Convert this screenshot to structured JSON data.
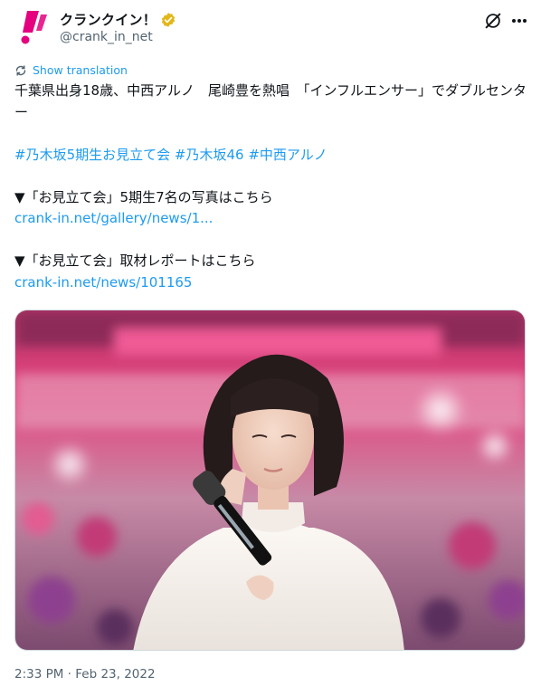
{
  "author": {
    "display_name": "クランクイン！",
    "handle": "@crank_in_net",
    "logo_glyph": "!"
  },
  "icons": {
    "verified": "verified-badge-icon",
    "grok": "grok-icon",
    "more": "more-icon",
    "translate": "translate-icon"
  },
  "colors": {
    "accent": "#1d9bf0",
    "brand_pink": "#e4007f",
    "verified_gold": "#e2b719"
  },
  "translate_label": "Show translation",
  "tweet": {
    "line1": "千葉県出身18歳、中西アルノ　尾崎豊を熱唱　「インフルエンサー」でダブルセンター",
    "hashtags": [
      "#乃木坂5期生お見立て会",
      "#乃木坂46",
      "#中西アルノ"
    ],
    "gallery_text": "▼「お見立て会」5期生7名の写真はこちら",
    "gallery_link": "crank-in.net/gallery/news/1...",
    "report_text": "▼「お見立て会」取材レポートはこちら",
    "report_link": "crank-in.net/news/101165"
  },
  "timestamp": "2:33 PM · Feb 23, 2022"
}
